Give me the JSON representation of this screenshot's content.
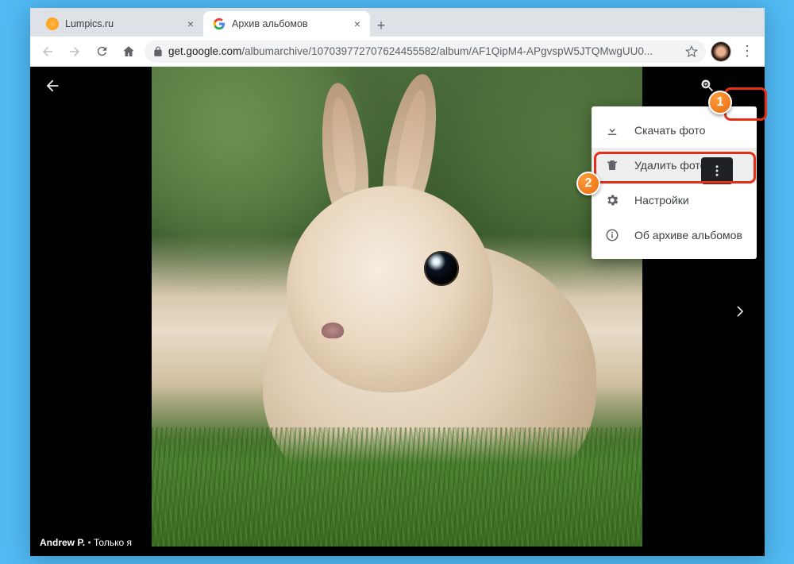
{
  "window_controls": {
    "min": "—",
    "max": "☐",
    "close": "✕"
  },
  "tabs": [
    {
      "title": "Lumpics.ru",
      "active": false
    },
    {
      "title": "Архив альбомов",
      "active": true
    }
  ],
  "new_tab_label": "+",
  "addressbar": {
    "host": "get.google.com",
    "path": "/albumarchive/107039772707624455582/album/AF1QipM4-APgvspW5JTQMwgUU0..."
  },
  "viewer": {
    "author": "Andrew P.",
    "separator": "•",
    "visibility": "Только я"
  },
  "menu": {
    "download": "Скачать фото",
    "delete": "Удалить фото",
    "settings": "Настройки",
    "about": "Об архиве альбомов"
  },
  "callouts": {
    "one": "1",
    "two": "2"
  }
}
